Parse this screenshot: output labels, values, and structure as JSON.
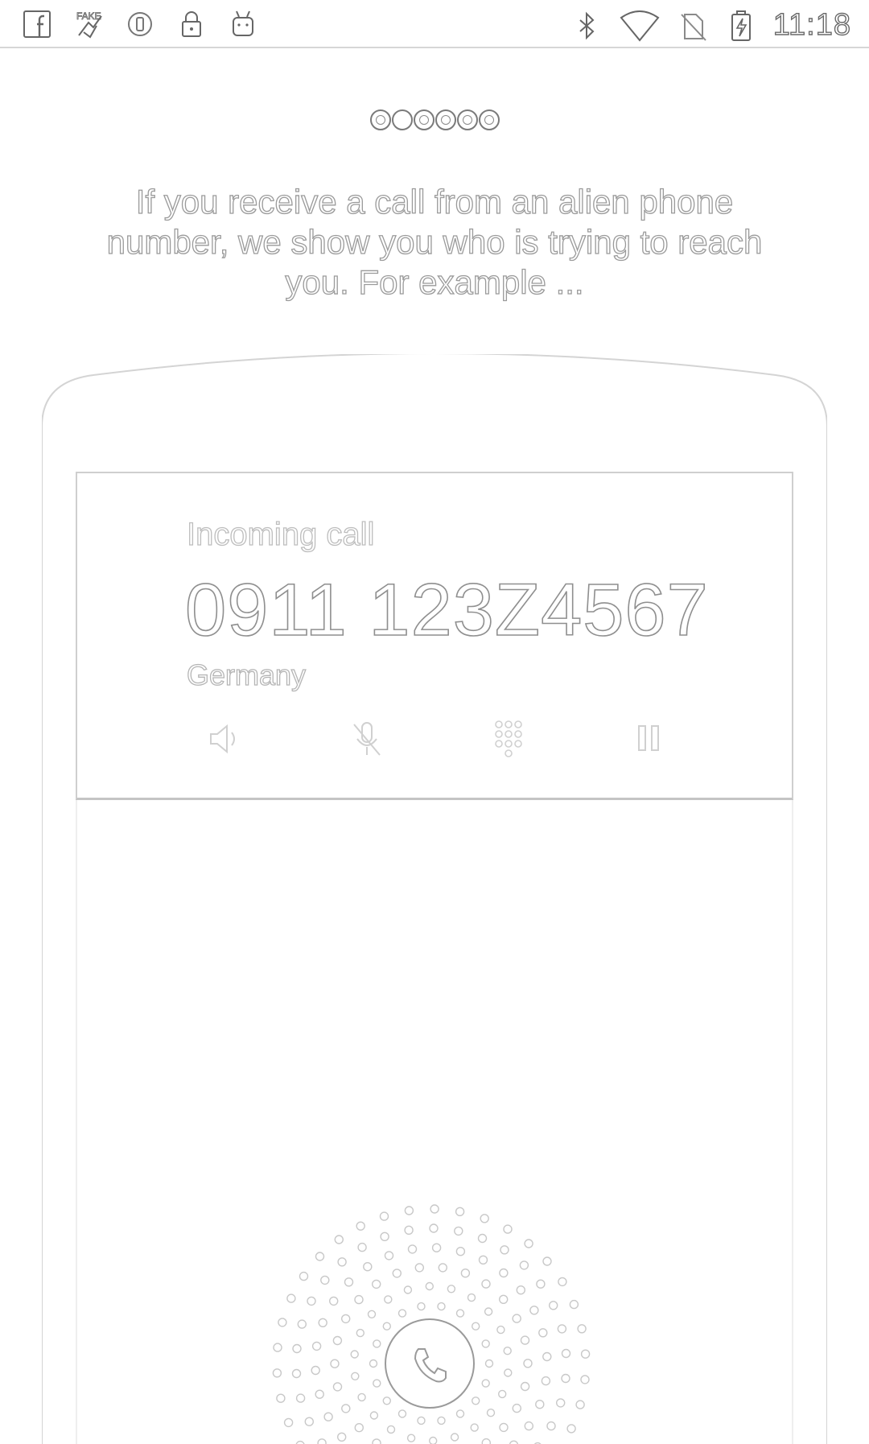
{
  "status_bar": {
    "time": "11:18",
    "left_icons": [
      "facebook-icon",
      "fake-gps-icon",
      "sync-icon",
      "lock-icon",
      "android-icon"
    ],
    "right_icons": [
      "bluetooth-icon",
      "wifi-icon",
      "no-sim-icon",
      "battery-charging-icon"
    ]
  },
  "pager": {
    "total_pages": 6,
    "active_index": 1
  },
  "intro": {
    "text": "If you receive a call from an alien phone number, we show you who is trying to reach you. For example ..."
  },
  "call_card": {
    "label": "Incoming call",
    "number": "0911 123Z4567",
    "country": "Germany",
    "actions": [
      "speaker-icon",
      "mute-icon",
      "dialpad-icon",
      "hold-icon"
    ]
  },
  "answer": {
    "icon": "phone-icon"
  }
}
